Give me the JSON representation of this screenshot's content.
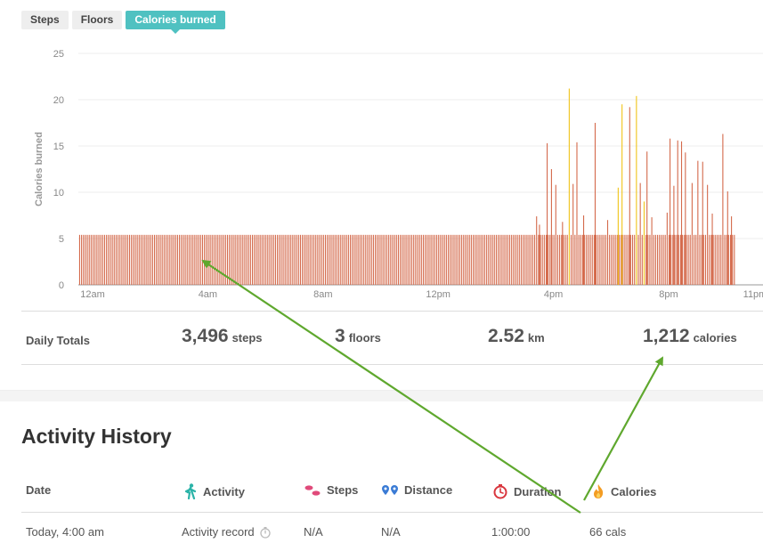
{
  "tabs": [
    {
      "label": "Steps",
      "active": false
    },
    {
      "label": "Floors",
      "active": false
    },
    {
      "label": "Calories burned",
      "active": true
    }
  ],
  "chart_data": {
    "type": "bar",
    "ylabel": "Calories burned",
    "ylim": [
      0,
      25
    ],
    "yticks": [
      "0",
      "5",
      "10",
      "15",
      "20",
      "25"
    ],
    "xticks": [
      "12am",
      "4am",
      "8am",
      "12pm",
      "4pm",
      "8pm",
      "11pm"
    ],
    "x_unit": "minutes after midnight",
    "baseline_value": 5.4,
    "baseline_range": [
      0,
      920
    ],
    "spikes": [
      {
        "x": 924,
        "y": 7.4
      },
      {
        "x": 930,
        "y": 6.5
      },
      {
        "x": 946,
        "y": 15.3
      },
      {
        "x": 955,
        "y": 12.5
      },
      {
        "x": 964,
        "y": 10.8
      },
      {
        "x": 978,
        "y": 6.8
      },
      {
        "x": 992,
        "y": 21.2,
        "color": "yellow"
      },
      {
        "x": 1000,
        "y": 10.9
      },
      {
        "x": 1008,
        "y": 15.4
      },
      {
        "x": 1022,
        "y": 7.5
      },
      {
        "x": 1046,
        "y": 17.5
      },
      {
        "x": 1072,
        "y": 7.0
      },
      {
        "x": 1094,
        "y": 10.5,
        "color": "yellow"
      },
      {
        "x": 1102,
        "y": 19.5,
        "color": "yellow"
      },
      {
        "x": 1118,
        "y": 19.2
      },
      {
        "x": 1132,
        "y": 20.4,
        "color": "yellow"
      },
      {
        "x": 1140,
        "y": 11.0
      },
      {
        "x": 1148,
        "y": 9.0,
        "color": "yellow"
      },
      {
        "x": 1154,
        "y": 14.4
      },
      {
        "x": 1164,
        "y": 7.3
      },
      {
        "x": 1196,
        "y": 7.8
      },
      {
        "x": 1202,
        "y": 15.8
      },
      {
        "x": 1210,
        "y": 10.7
      },
      {
        "x": 1218,
        "y": 15.6
      },
      {
        "x": 1226,
        "y": 15.5
      },
      {
        "x": 1234,
        "y": 14.3
      },
      {
        "x": 1248,
        "y": 11.0
      },
      {
        "x": 1260,
        "y": 13.4
      },
      {
        "x": 1270,
        "y": 13.3
      },
      {
        "x": 1280,
        "y": 10.8
      },
      {
        "x": 1290,
        "y": 7.7
      },
      {
        "x": 1312,
        "y": 16.3
      },
      {
        "x": 1322,
        "y": 10.1
      },
      {
        "x": 1330,
        "y": 7.4
      }
    ],
    "series_color": "#d46a4c",
    "highlight_color": "#f0c419"
  },
  "daily_totals": {
    "label": "Daily Totals",
    "steps": {
      "value": "3,496",
      "unit": "steps"
    },
    "floors": {
      "value": "3",
      "unit": "floors"
    },
    "distance": {
      "value": "2.52",
      "unit": "km"
    },
    "calories": {
      "value": "1,212",
      "unit": "calories"
    }
  },
  "history": {
    "title": "Activity History",
    "columns": {
      "date": "Date",
      "activity": "Activity",
      "steps": "Steps",
      "distance": "Distance",
      "duration": "Duration",
      "calories": "Calories"
    },
    "rows": [
      {
        "date": "Today, 4:00 am",
        "activity": "Activity record",
        "steps": "N/A",
        "distance": "N/A",
        "duration": "1:00:00",
        "calories": "66 cals"
      }
    ]
  },
  "icons": {
    "activity": "walking-person-icon",
    "steps": "footprints-icon",
    "distance": "location-pins-icon",
    "duration": "stopwatch-icon",
    "calories": "flame-icon",
    "record": "timer-icon"
  },
  "colors": {
    "accent": "#4fc1c1",
    "annotation_arrow": "#5fa82e"
  }
}
